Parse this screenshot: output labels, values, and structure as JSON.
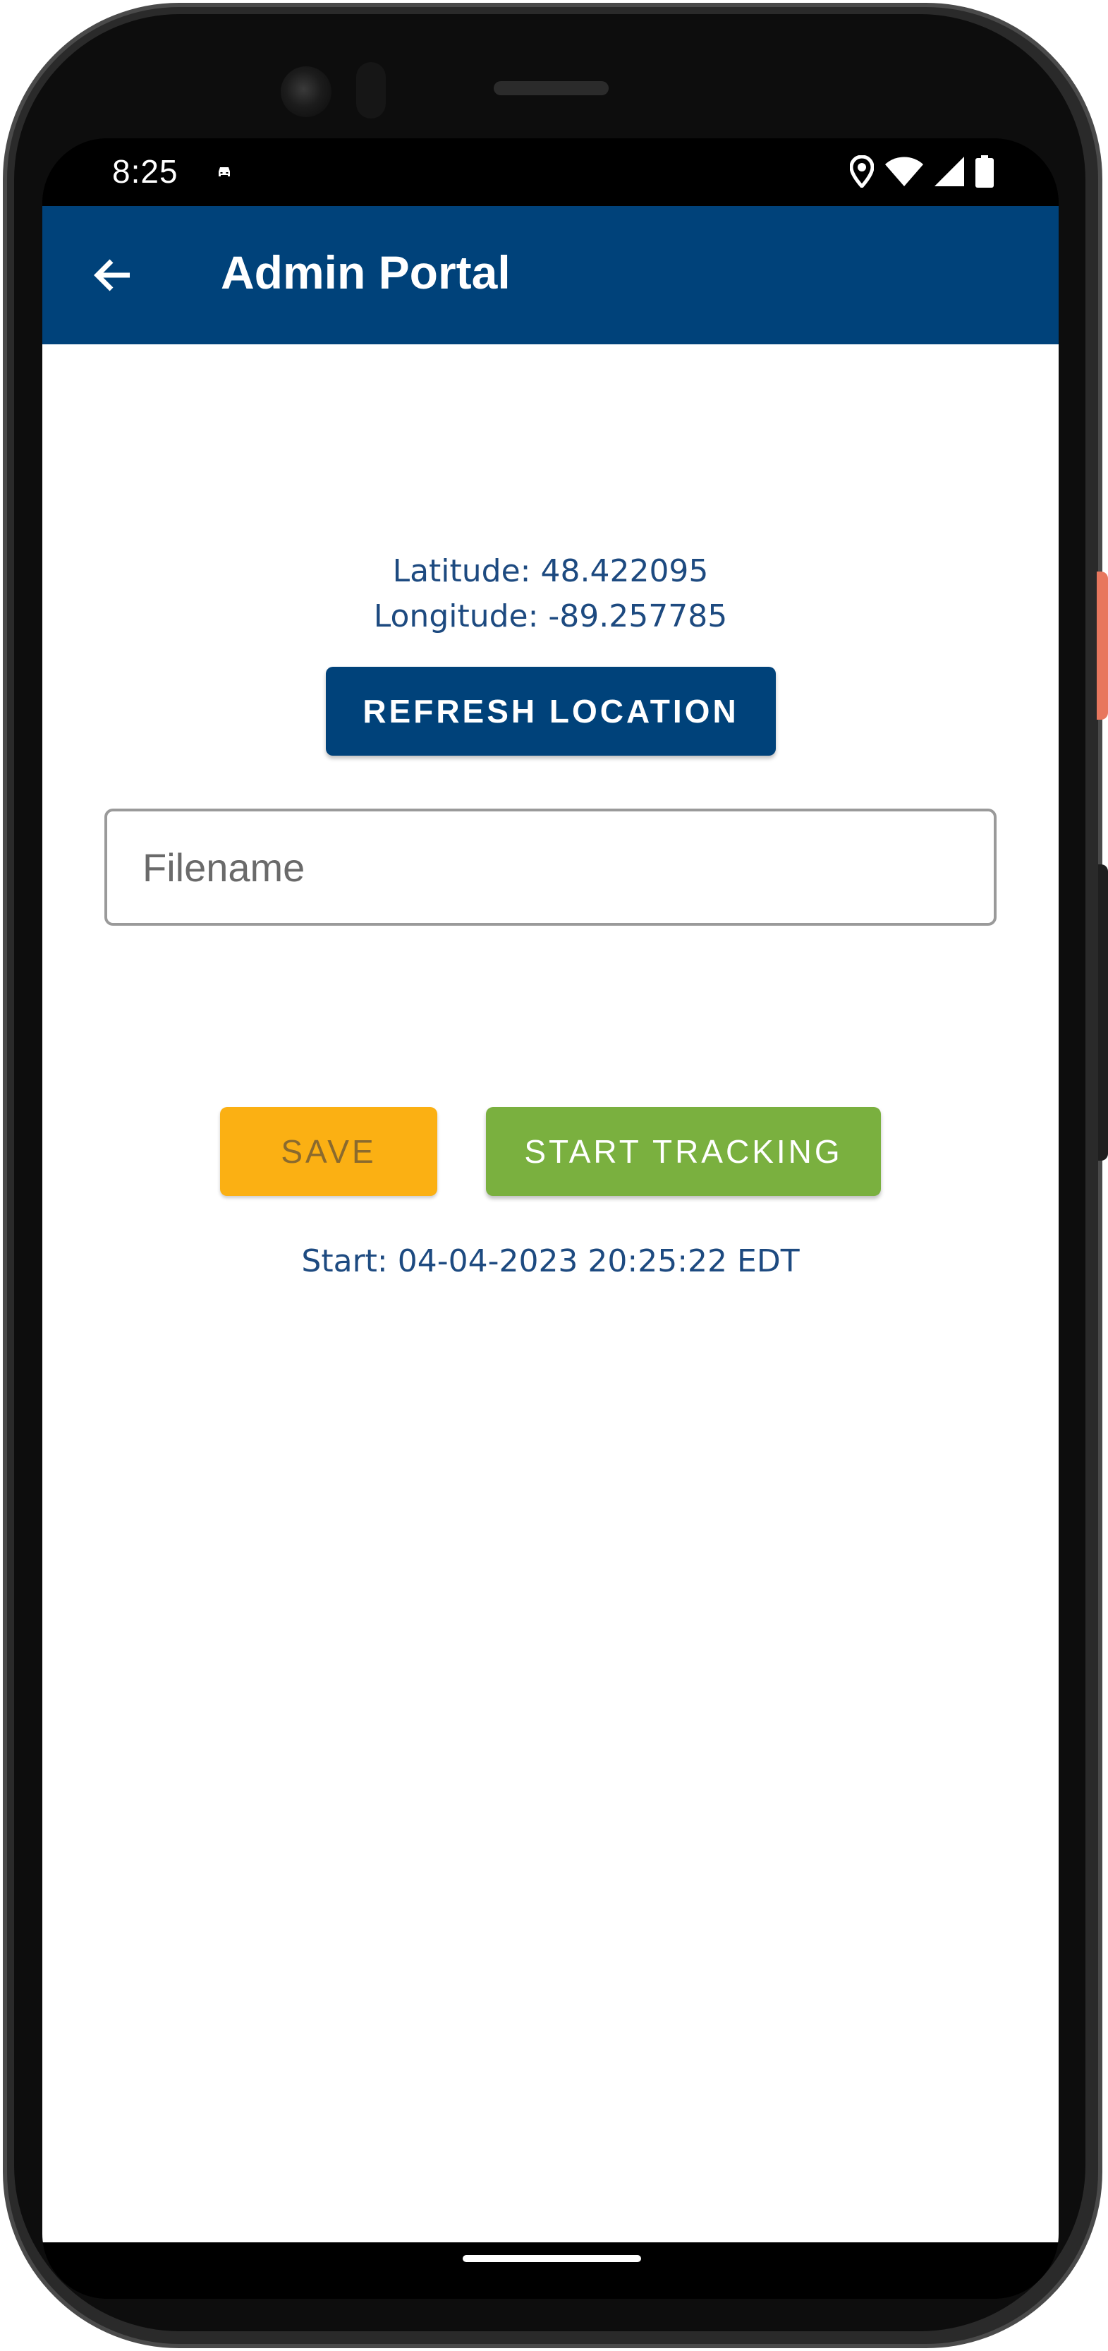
{
  "status_bar": {
    "time": "8:25",
    "icons": [
      "car-icon",
      "location-pin-icon",
      "wifi-icon",
      "signal-icon",
      "battery-icon"
    ]
  },
  "app_bar": {
    "title": "Admin Portal",
    "back_icon": "arrow-left-icon"
  },
  "location": {
    "latitude_text": "Latitude: 48.422095",
    "longitude_text": "Longitude: -89.257785"
  },
  "buttons": {
    "refresh_label": "REFRESH LOCATION",
    "save_label": "SAVE",
    "track_label": "START TRACKING"
  },
  "filename": {
    "value": "",
    "placeholder": "Filename"
  },
  "start_text": "Start: 04-04-2023 20:25:22 EDT",
  "colors": {
    "primary": "#00427a",
    "text_blue": "#1d4a80",
    "save": "#fbb013",
    "track": "#7ab03f"
  }
}
